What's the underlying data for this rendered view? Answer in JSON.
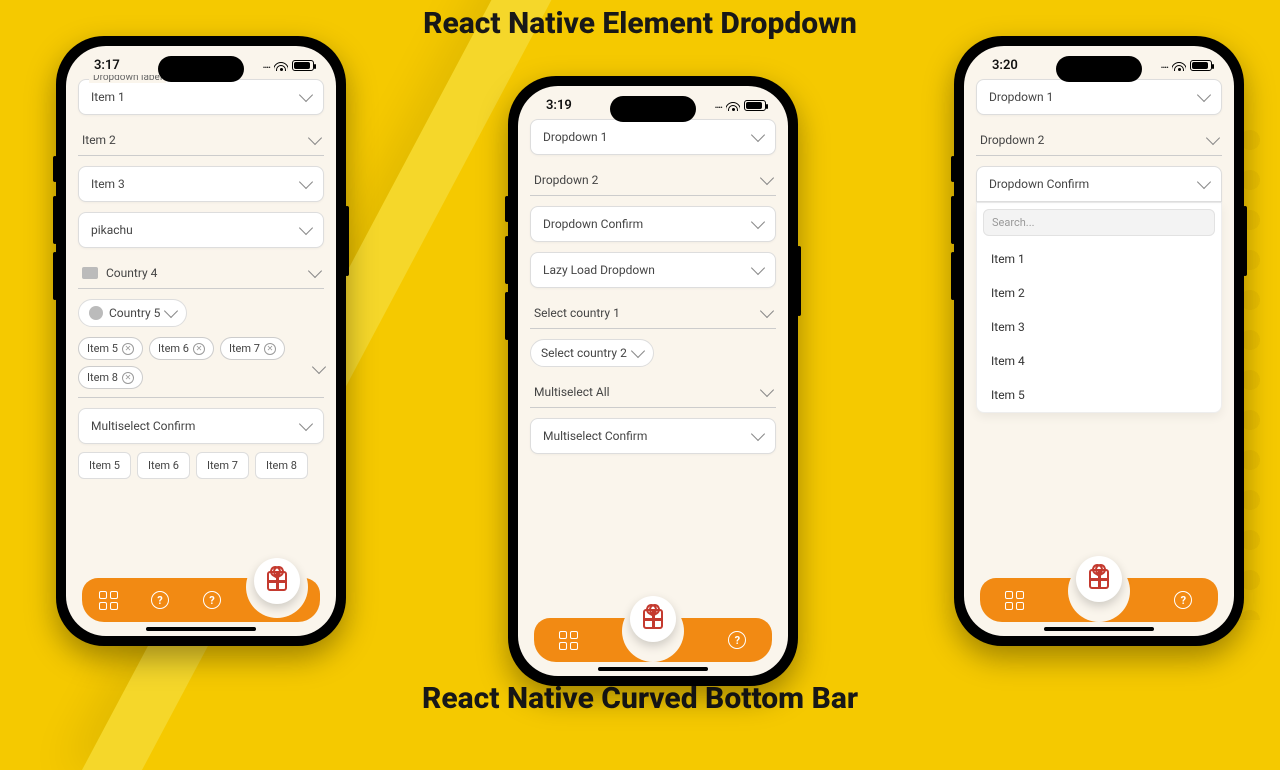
{
  "heading_top": "React Native Element Dropdown",
  "heading_bottom": "React Native Curved Bottom Bar",
  "phone1": {
    "time": "3:17",
    "d_label_floating": "Dropdown label",
    "d1": "Item 1",
    "d2": "Item 2",
    "d3": "Item 3",
    "d4": "pikachu",
    "country4": "Country 4",
    "country5": "Country 5",
    "chips": [
      "Item 5",
      "Item 6",
      "Item 7",
      "Item 8"
    ],
    "multiselect_confirm": "Multiselect Confirm",
    "multiselect_items": [
      "Item 5",
      "Item 6",
      "Item 7",
      "Item 8"
    ]
  },
  "phone2": {
    "time": "3:19",
    "d1": "Dropdown 1",
    "d2": "Dropdown 2",
    "d3": "Dropdown Confirm",
    "d4": "Lazy Load Dropdown",
    "d5": "Select country 1",
    "d6": "Select country 2",
    "d7": "Multiselect All",
    "d8": "Multiselect Confirm"
  },
  "phone3": {
    "time": "3:20",
    "d1": "Dropdown 1",
    "d2": "Dropdown 2",
    "d3": "Dropdown Confirm",
    "search_placeholder": "Search...",
    "options": [
      "Item 1",
      "Item 2",
      "Item 3",
      "Item 4",
      "Item 5"
    ]
  },
  "q": "?"
}
